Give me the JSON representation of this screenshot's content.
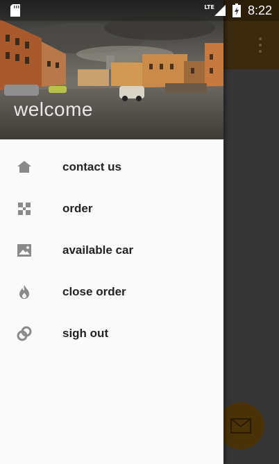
{
  "status_bar": {
    "network": "LTE",
    "time": "8:22"
  },
  "drawer": {
    "header": {
      "title": "welcome"
    },
    "items": [
      {
        "label": "contact us",
        "icon": "home-icon"
      },
      {
        "label": "order",
        "icon": "puzzle-icon"
      },
      {
        "label": "available car",
        "icon": "photo-icon"
      },
      {
        "label": "close order",
        "icon": "flame-icon"
      },
      {
        "label": "sigh out",
        "icon": "link-icon"
      }
    ]
  },
  "app": {
    "fab_icon": "mail-icon",
    "overflow_icon": "more-vert-icon"
  },
  "colors": {
    "drawer_bg": "#fafafa",
    "toolbar_bg": "#3b2a0e",
    "fab_bg": "#4a3208",
    "icon_gray": "#8a8a8a"
  }
}
